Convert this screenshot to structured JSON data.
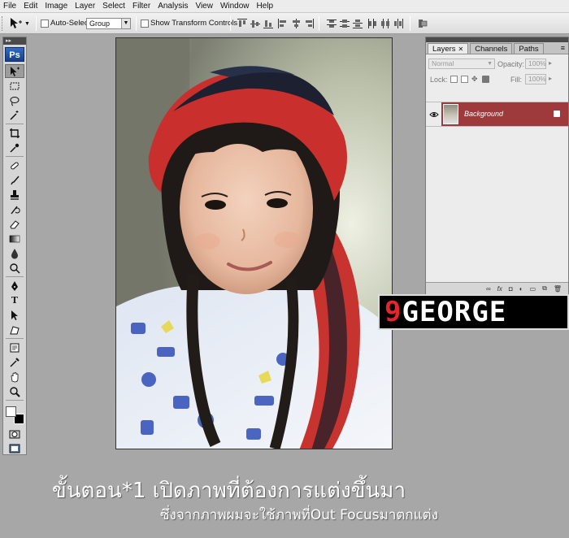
{
  "menu": [
    "File",
    "Edit",
    "Image",
    "Layer",
    "Select",
    "Filter",
    "Analysis",
    "View",
    "Window",
    "Help"
  ],
  "options": {
    "auto_select_label": "Auto-Select:",
    "auto_select_value": "Group",
    "show_transform_label": "Show Transform Controls"
  },
  "toolbox": {
    "logo": "Ps",
    "type_tool_glyph": "T"
  },
  "layers_panel": {
    "tabs": [
      "Layers",
      "Channels",
      "Paths"
    ],
    "blend_mode": "Normal",
    "opacity_label": "Opacity:",
    "opacity_value": "100%",
    "lock_label": "Lock:",
    "fill_label": "Fill:",
    "fill_value": "100%",
    "layer_name": "Background",
    "footer_icons": [
      "link-icon",
      "fx-icon",
      "mask-icon",
      "adjustment-icon",
      "group-icon",
      "new-layer-icon",
      "trash-icon"
    ]
  },
  "logo_band": {
    "digit": "9",
    "text": "GEORGE",
    "colors": {
      "digit": "#e3262b",
      "text": "#ffffff",
      "background": "#000000"
    }
  },
  "caption": {
    "line1": "ขั้นตอน*1  เปิดภาพที่ต้องการแต่งขึ้นมา",
    "line2": "ซึ่งจากภาพผมจะใช้ภาพที่Out Focusมาตกแต่ง"
  },
  "colors": {
    "workspace": "#a7a7a7",
    "selected_layer": "#9e3a3c",
    "ps_logo": "#1f4fa0"
  }
}
